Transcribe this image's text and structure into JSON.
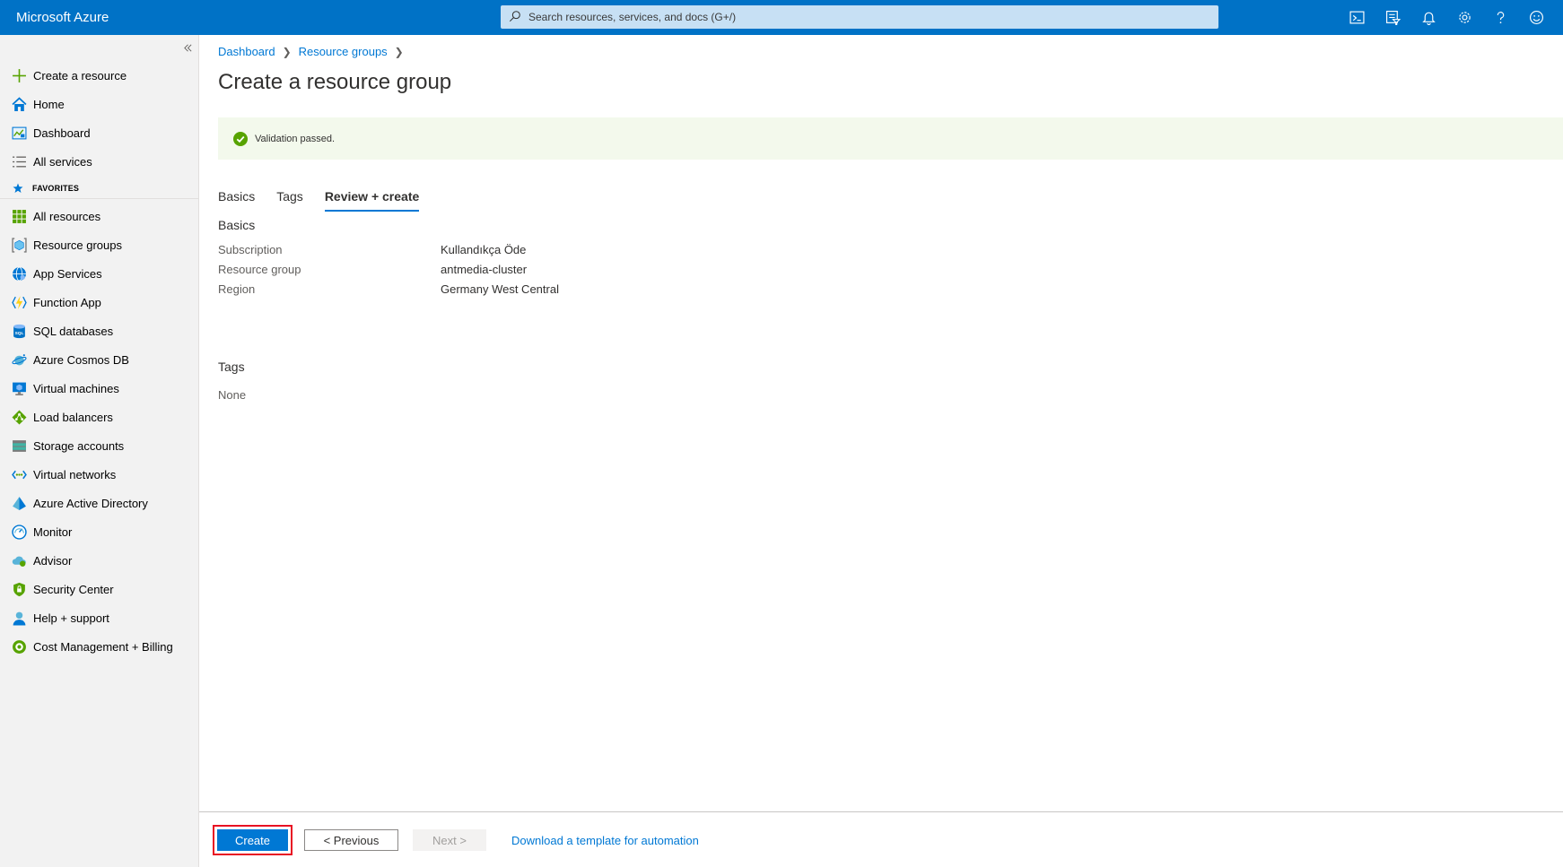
{
  "app": {
    "title": "Microsoft Azure"
  },
  "search": {
    "placeholder": "Search resources, services, and docs (G+/)"
  },
  "header_icons": [
    "cloud-shell-icon",
    "directory-filter-icon",
    "notifications-icon",
    "settings-icon",
    "help-icon",
    "feedback-icon"
  ],
  "sidebar": {
    "top_items": [
      {
        "label": "Create a resource",
        "icon": "plus-icon"
      },
      {
        "label": "Home",
        "icon": "home-icon"
      },
      {
        "label": "Dashboard",
        "icon": "dashboard-icon"
      },
      {
        "label": "All services",
        "icon": "list-icon"
      }
    ],
    "favorites_label": "FAVORITES",
    "favorites": [
      {
        "label": "All resources",
        "icon": "grid-icon"
      },
      {
        "label": "Resource groups",
        "icon": "resource-group-icon"
      },
      {
        "label": "App Services",
        "icon": "globe-icon"
      },
      {
        "label": "Function App",
        "icon": "bolt-icon"
      },
      {
        "label": "SQL databases",
        "icon": "sql-icon"
      },
      {
        "label": "Azure Cosmos DB",
        "icon": "planet-icon"
      },
      {
        "label": "Virtual machines",
        "icon": "monitor-icon"
      },
      {
        "label": "Load balancers",
        "icon": "diamond-icon"
      },
      {
        "label": "Storage accounts",
        "icon": "storage-icon"
      },
      {
        "label": "Virtual networks",
        "icon": "network-icon"
      },
      {
        "label": "Azure Active Directory",
        "icon": "pyramid-icon"
      },
      {
        "label": "Monitor",
        "icon": "gauge-icon"
      },
      {
        "label": "Advisor",
        "icon": "cloud-icon"
      },
      {
        "label": "Security Center",
        "icon": "shield-icon"
      },
      {
        "label": "Help + support",
        "icon": "person-icon"
      },
      {
        "label": "Cost Management + Billing",
        "icon": "coin-icon"
      }
    ]
  },
  "breadcrumb": [
    "Dashboard",
    "Resource groups"
  ],
  "page_title": "Create a resource group",
  "validation": {
    "message": "Validation passed.",
    "status_color": "#57a300"
  },
  "tabs": [
    {
      "label": "Basics",
      "active": false
    },
    {
      "label": "Tags",
      "active": false
    },
    {
      "label": "Review + create",
      "active": true
    }
  ],
  "review": {
    "basics_title": "Basics",
    "fields": [
      {
        "key": "Subscription",
        "value": "Kullandıkça Öde"
      },
      {
        "key": "Resource group",
        "value": "antmedia-cluster"
      },
      {
        "key": "Region",
        "value": "Germany West Central"
      }
    ],
    "tags_title": "Tags",
    "tags_value": "None"
  },
  "footer": {
    "create_label": "Create",
    "previous_label": "< Previous",
    "next_label": "Next >",
    "template_link": "Download a template for automation"
  },
  "colors": {
    "accent": "#0078d4",
    "topbar": "#0072c6",
    "highlight": "#e81123"
  }
}
